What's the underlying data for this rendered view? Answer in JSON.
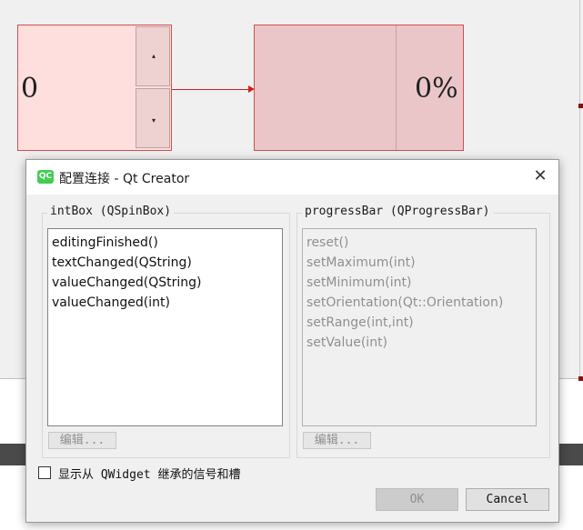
{
  "canvas": {
    "spinbox": {
      "value": "0",
      "up_arrow": "▴",
      "down_arrow": "▾"
    },
    "progressbar": {
      "value_text": "0%"
    }
  },
  "dialog": {
    "logo_text": "QC",
    "title": "配置连接 - Qt Creator",
    "close_icon": "✕",
    "sender": {
      "title": "intBox (QSpinBox)",
      "signals": [
        "editingFinished()",
        "textChanged(QString)",
        "valueChanged(QString)",
        "valueChanged(int)"
      ],
      "edit_label": "编辑..."
    },
    "receiver": {
      "title": "progressBar (QProgressBar)",
      "slots": [
        "reset()",
        "setMaximum(int)",
        "setMinimum(int)",
        "setOrientation(Qt::Orientation)",
        "setRange(int,int)",
        "setValue(int)"
      ],
      "edit_label": "编辑..."
    },
    "show_inherited_label": "显示从 QWidget 继承的信号和槽",
    "ok_label": "OK",
    "cancel_label": "Cancel"
  },
  "colors": {
    "qt_green": "#41cd52",
    "connection_red": "#d02020",
    "selection_pink": "#ffdede"
  }
}
